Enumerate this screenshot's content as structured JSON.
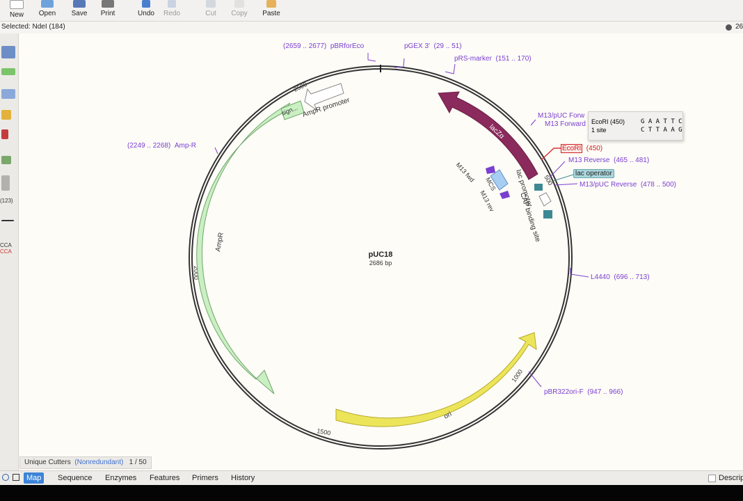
{
  "toolbar": {
    "new": "New",
    "open": "Open",
    "save": "Save",
    "print": "Print",
    "undo": "Undo",
    "redo": "Redo",
    "cut": "Cut",
    "copy": "Copy",
    "paste": "Paste"
  },
  "selection": {
    "text": "Selected:  NdeI  (184)",
    "right_text": "26"
  },
  "sidebar_labels": {
    "counter": "(123)",
    "seq_top": "CCA",
    "seq_bottom": "CCA"
  },
  "map": {
    "name": "pUC18",
    "size": "2686 bp",
    "ticks": [
      "2500",
      "2000",
      "1500",
      "1000",
      "500"
    ],
    "feature_names": {
      "lacZa": "lacZα",
      "ampr": "AmpR",
      "ampr_promoter": "AmpR promoter",
      "sign": "sign...",
      "ori": "ori",
      "lac_promoter": "lac promoter",
      "cap": "CAP binding site",
      "mcs": "MCS",
      "m13fwd": "M13 fwd",
      "m13rev": "M13 rev"
    },
    "labels": [
      {
        "key": "pbrforeco",
        "range": "(2659 .. 2677)",
        "name": "pBRforEco"
      },
      {
        "key": "pgex",
        "name": "pGEX 3'",
        "range": "(29 .. 51)"
      },
      {
        "key": "prs",
        "name": "pRS-marker",
        "range": "(151 .. 170)"
      },
      {
        "key": "m13puc_fwd",
        "name": "M13/pUC Forw"
      },
      {
        "key": "m13_fwd",
        "name": "M13 Forward"
      },
      {
        "key": "ecori",
        "name": "EcoRI",
        "range": "(450)"
      },
      {
        "key": "m13_rev",
        "name": "M13 Reverse",
        "range": "(465 .. 481)"
      },
      {
        "key": "lac_op",
        "name": "lac operator"
      },
      {
        "key": "m13puc_rev",
        "name": "M13/pUC Reverse",
        "range": "(478 .. 500)"
      },
      {
        "key": "ampr_primer",
        "range": "(2249 .. 2268)",
        "name": "Amp-R"
      },
      {
        "key": "l4440",
        "name": "L4440",
        "range": "(696 .. 713)"
      },
      {
        "key": "pbr322",
        "name": "pBR322ori-F",
        "range": "(947 .. 966)"
      }
    ]
  },
  "popup": {
    "enzyme": "EcoRI  (450)",
    "sites": "1 site",
    "seq_top": "G A A T T C",
    "seq_bottom": "C T T A A G"
  },
  "status": {
    "label": "Unique Cutters",
    "mode": "(Nonredundant)",
    "count": "1 / 50"
  },
  "tabs": [
    "Map",
    "Sequence",
    "Enzymes",
    "Features",
    "Primers",
    "History"
  ],
  "right_tab": "Descrip",
  "colors": {
    "lacz": "#8b2a5c",
    "ampr": "#c9efc2",
    "ori": "#ece55a",
    "label": "#7a3fd0",
    "tab_active": "#3c84d8"
  }
}
